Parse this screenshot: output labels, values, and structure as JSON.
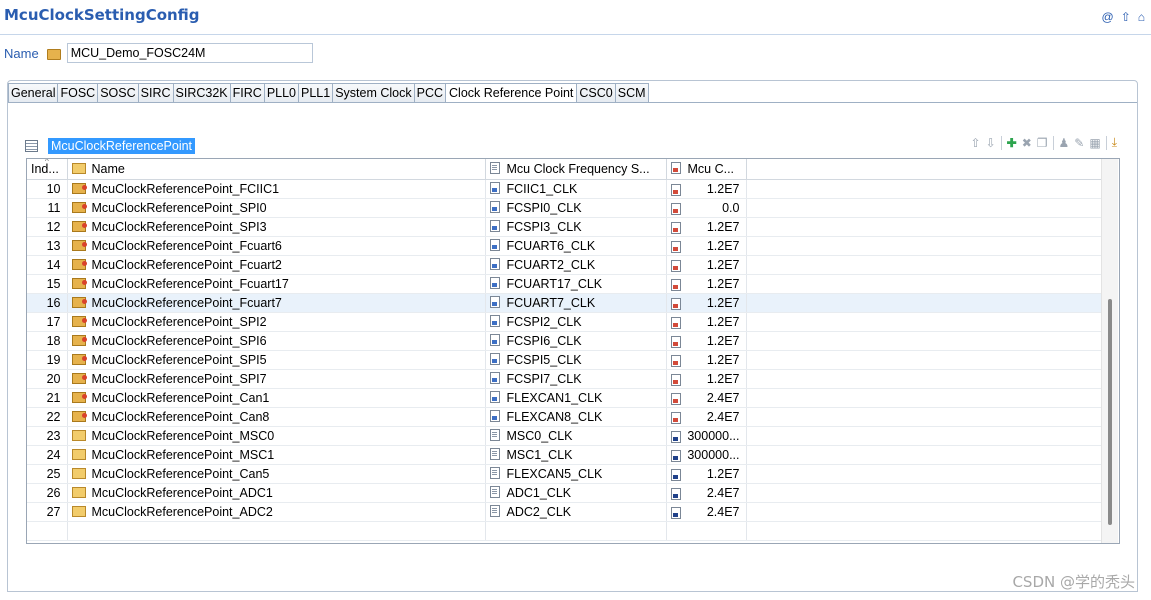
{
  "app": {
    "title": "McuClockSettingConfig"
  },
  "top_icons": {
    "icon1": "@",
    "icon2": "⇧",
    "icon3": "⌂"
  },
  "name_row": {
    "label": "Name",
    "value": "MCU_Demo_FOSC24M"
  },
  "tabs": [
    {
      "label": "General"
    },
    {
      "label": "FOSC"
    },
    {
      "label": "SOSC"
    },
    {
      "label": "SIRC"
    },
    {
      "label": "SIRC32K"
    },
    {
      "label": "FIRC"
    },
    {
      "label": "PLL0"
    },
    {
      "label": "PLL1"
    },
    {
      "label": "System Clock"
    },
    {
      "label": "PCC"
    },
    {
      "label": "Clock Reference Point"
    },
    {
      "label": "CSC0"
    },
    {
      "label": "SCM"
    }
  ],
  "active_tab": "Clock Reference Point",
  "section": {
    "title": "McuClockReferencePoint"
  },
  "toolbar": {
    "up": "⇧",
    "down": "⇩",
    "add": "✚",
    "delete": "✖",
    "copy": "❐",
    "user": "♟",
    "edit": "✎",
    "table": "▦",
    "import": "⤓"
  },
  "table": {
    "headers": {
      "index": "Ind...",
      "name": "Name",
      "freq": "Mcu Clock Frequency S...",
      "value": "Mcu C..."
    },
    "rows": [
      {
        "idx": "10",
        "name": "McuClockReferencePoint_FCIIC1",
        "freq": "FCIIC1_CLK",
        "value": "1.2E7",
        "icon": "star",
        "freq_icon": "blue",
        "val_icon": "red"
      },
      {
        "idx": "11",
        "name": "McuClockReferencePoint_SPI0",
        "freq": "FCSPI0_CLK",
        "value": "0.0",
        "icon": "star",
        "freq_icon": "blue",
        "val_icon": "red"
      },
      {
        "idx": "12",
        "name": "McuClockReferencePoint_SPI3",
        "freq": "FCSPI3_CLK",
        "value": "1.2E7",
        "icon": "star",
        "freq_icon": "blue",
        "val_icon": "red"
      },
      {
        "idx": "13",
        "name": "McuClockReferencePoint_Fcuart6",
        "freq": "FCUART6_CLK",
        "value": "1.2E7",
        "icon": "star",
        "freq_icon": "blue",
        "val_icon": "red"
      },
      {
        "idx": "14",
        "name": "McuClockReferencePoint_Fcuart2",
        "freq": "FCUART2_CLK",
        "value": "1.2E7",
        "icon": "star",
        "freq_icon": "blue",
        "val_icon": "red"
      },
      {
        "idx": "15",
        "name": "McuClockReferencePoint_Fcuart17",
        "freq": "FCUART17_CLK",
        "value": "1.2E7",
        "icon": "star",
        "freq_icon": "blue",
        "val_icon": "red"
      },
      {
        "idx": "16",
        "name": "McuClockReferencePoint_Fcuart7",
        "freq": "FCUART7_CLK",
        "value": "1.2E7",
        "icon": "star",
        "freq_icon": "blue",
        "val_icon": "red",
        "selected": true
      },
      {
        "idx": "17",
        "name": "McuClockReferencePoint_SPI2",
        "freq": "FCSPI2_CLK",
        "value": "1.2E7",
        "icon": "star",
        "freq_icon": "blue",
        "val_icon": "red"
      },
      {
        "idx": "18",
        "name": "McuClockReferencePoint_SPI6",
        "freq": "FCSPI6_CLK",
        "value": "1.2E7",
        "icon": "star",
        "freq_icon": "blue",
        "val_icon": "red"
      },
      {
        "idx": "19",
        "name": "McuClockReferencePoint_SPI5",
        "freq": "FCSPI5_CLK",
        "value": "1.2E7",
        "icon": "star",
        "freq_icon": "blue",
        "val_icon": "red"
      },
      {
        "idx": "20",
        "name": "McuClockReferencePoint_SPI7",
        "freq": "FCSPI7_CLK",
        "value": "1.2E7",
        "icon": "star",
        "freq_icon": "blue",
        "val_icon": "red"
      },
      {
        "idx": "21",
        "name": "McuClockReferencePoint_Can1",
        "freq": "FLEXCAN1_CLK",
        "value": "2.4E7",
        "icon": "star",
        "freq_icon": "blue",
        "val_icon": "red"
      },
      {
        "idx": "22",
        "name": "McuClockReferencePoint_Can8",
        "freq": "FLEXCAN8_CLK",
        "value": "2.4E7",
        "icon": "star",
        "freq_icon": "blue",
        "val_icon": "red"
      },
      {
        "idx": "23",
        "name": "McuClockReferencePoint_MSC0",
        "freq": "MSC0_CLK",
        "value": "300000...",
        "icon": "open",
        "freq_icon": "plain",
        "val_icon": "dblue"
      },
      {
        "idx": "24",
        "name": "McuClockReferencePoint_MSC1",
        "freq": "MSC1_CLK",
        "value": "300000...",
        "icon": "open",
        "freq_icon": "plain",
        "val_icon": "dblue"
      },
      {
        "idx": "25",
        "name": "McuClockReferencePoint_Can5",
        "freq": "FLEXCAN5_CLK",
        "value": "1.2E7",
        "icon": "open",
        "freq_icon": "plain",
        "val_icon": "dblue"
      },
      {
        "idx": "26",
        "name": "McuClockReferencePoint_ADC1",
        "freq": "ADC1_CLK",
        "value": "2.4E7",
        "icon": "open",
        "freq_icon": "plain",
        "val_icon": "dblue"
      },
      {
        "idx": "27",
        "name": "McuClockReferencePoint_ADC2",
        "freq": "ADC2_CLK",
        "value": "2.4E7",
        "icon": "open",
        "freq_icon": "plain",
        "val_icon": "dblue"
      }
    ]
  },
  "watermark": "CSDN @学的秃头"
}
